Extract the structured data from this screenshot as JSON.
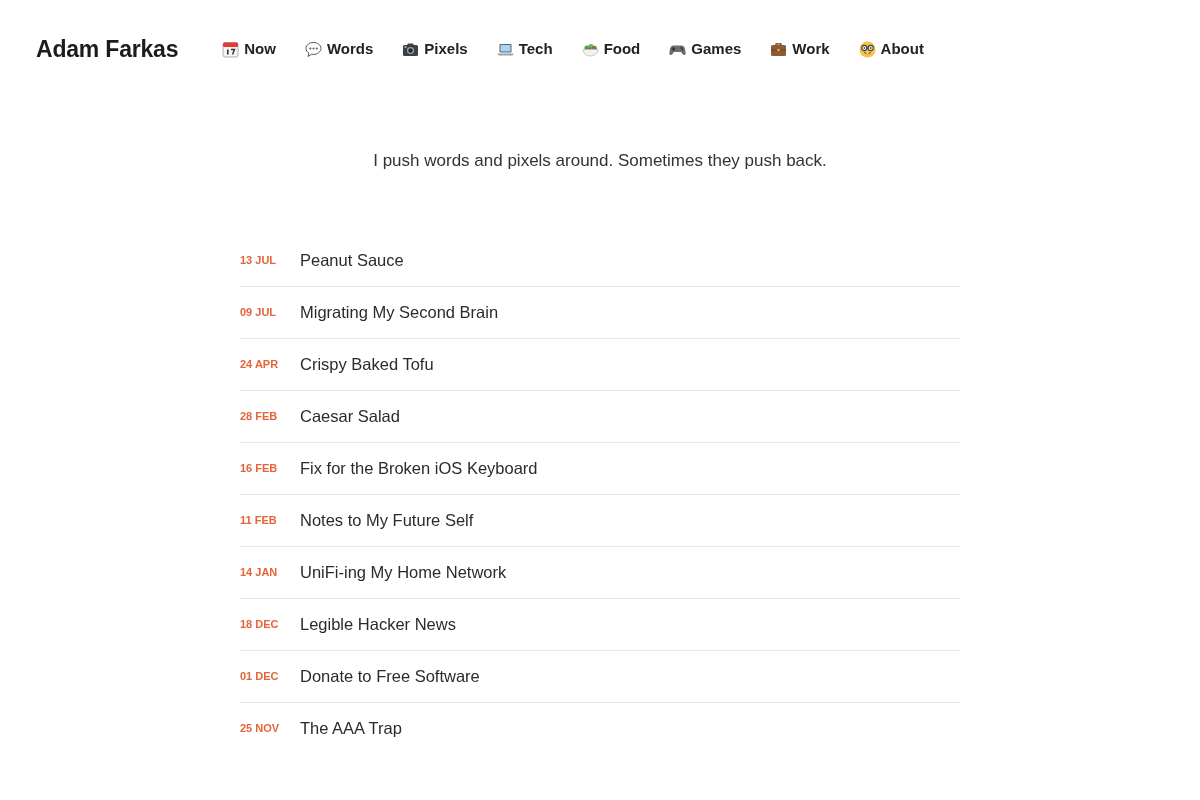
{
  "site": {
    "title": "Adam Farkas"
  },
  "nav": [
    {
      "label": "Now"
    },
    {
      "label": "Words"
    },
    {
      "label": "Pixels"
    },
    {
      "label": "Tech"
    },
    {
      "label": "Food"
    },
    {
      "label": "Games"
    },
    {
      "label": "Work"
    },
    {
      "label": "About"
    }
  ],
  "tagline": "I push words and pixels around. Sometimes they push back.",
  "posts": [
    {
      "date": "13 JUL",
      "title": "Peanut Sauce"
    },
    {
      "date": "09 JUL",
      "title": "Migrating My Second Brain"
    },
    {
      "date": "24 APR",
      "title": "Crispy Baked Tofu"
    },
    {
      "date": "28 FEB",
      "title": "Caesar Salad"
    },
    {
      "date": "16 FEB",
      "title": "Fix for the Broken iOS Keyboard"
    },
    {
      "date": "11 FEB",
      "title": "Notes to My Future Self"
    },
    {
      "date": "14 JAN",
      "title": "UniFi-ing My Home Network"
    },
    {
      "date": "18 DEC",
      "title": "Legible Hacker News"
    },
    {
      "date": "01 DEC",
      "title": "Donate to Free Software"
    },
    {
      "date": "25 NOV",
      "title": "The AAA Trap"
    }
  ]
}
